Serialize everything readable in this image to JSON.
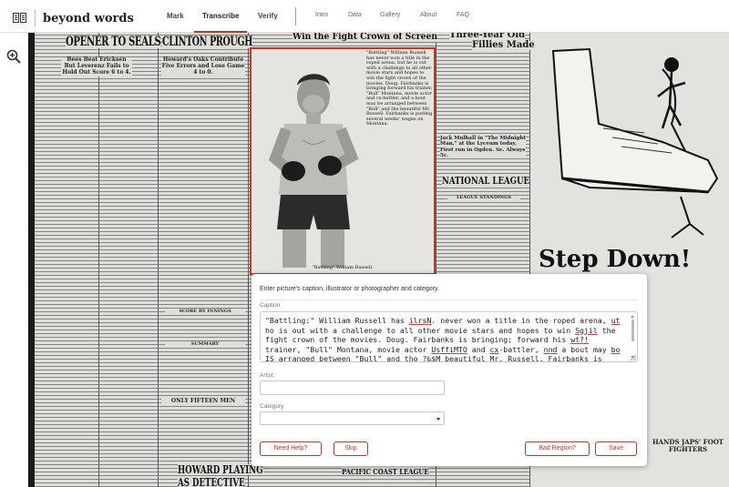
{
  "app": {
    "name": "beyond words",
    "logo_icon": "book-icon"
  },
  "nav": {
    "tabs": [
      {
        "label": "Mark",
        "active": false
      },
      {
        "label": "Transcribe",
        "active": true
      },
      {
        "label": "Verify",
        "active": false
      }
    ],
    "links": [
      "Intro",
      "Data",
      "Gallery",
      "About",
      "FAQ"
    ]
  },
  "tools": {
    "zoom_icon": "zoom-in-icon"
  },
  "newspaper": {
    "headlines": [
      "OPENER TO SEALS",
      "CLINTON PROUGH",
      "Win the Fight Crown of Screen",
      "Three-Year Old",
      "Fillies Made",
      "NATIONAL LEAGUE",
      "Step Down!",
      "HOWARD PLAYING",
      "AS DETECTIVE",
      "PACIFIC COAST LEAGUE"
    ],
    "subheads": [
      "Bees Beat Ericksen But Leverenz Fails to Hold Out Score 6 to 4.",
      "Howard's Oaks Contribute Five Errors and Lose Game 4 to 0.",
      "LEAGUE STANDINGS",
      "Jack Mulhall in \"The Midnight Man,\" at the Lyceum today. First run in Ogden. Se. Always 5c.",
      "ONLY FIFTEEN MEN",
      "SCORE BY INNINGS",
      "SUMMARY",
      "HANDS JAPS' FOOT FIGHTERS"
    ],
    "photo_blurb": "\"Battling\" William Russell has never won a title in the roped arena, but he is out with a challenge to all other movie stars and hopes to win the fight crown of the movies. Doug. Fairbanks is bringing forward his trainer, \"Bull\" Montana, movie actor and cx-battler, and a bout may be arranged between \"Bull\" and the beautiful Mr. Russell. Fairbanks is putting several weeks' wages on Montana.",
    "photo_caption": "\"Battling\" William Russell."
  },
  "dialog": {
    "instruction": "Enter picture's caption, illustrator or photographer and category.",
    "caption_label": "Caption",
    "caption_segments": [
      {
        "text": "\"Battling:\" William Russell has ",
        "flag": false
      },
      {
        "text": "ilrsN",
        "flag": true
      },
      {
        "text": ". never won a title in the roped arena, ",
        "flag": false
      },
      {
        "text": "ut",
        "flag": true
      },
      {
        "text": " ho is out with a challenge to all other movie stars and hopes to win ",
        "flag": false
      },
      {
        "text": "Sgjil",
        "flag": true
      },
      {
        "text": " the fight crown of the movies. Doug. Fairbanks is bringing; forward his ",
        "flag": false
      },
      {
        "text": "wt?!",
        "flag": true
      },
      {
        "text": " trainer, \"Bull\" Montana, movie actor ",
        "flag": false
      },
      {
        "text": "UsffiMTO",
        "flag": true
      },
      {
        "text": " and ",
        "flag": false
      },
      {
        "text": "cx",
        "flag": true
      },
      {
        "text": "-battler, ",
        "flag": false
      },
      {
        "text": "nnd",
        "flag": true
      },
      {
        "text": " a bout may ",
        "flag": false
      },
      {
        "text": "bo",
        "flag": true
      },
      {
        "text": " IS arranged between \"Bull\" and tho ",
        "flag": false
      },
      {
        "text": "?‰$M",
        "flag": true
      },
      {
        "text": " beautiful Mr. Russell. Fairbanks is",
        "flag": false
      }
    ],
    "artist_label": "Artist",
    "artist_value": "",
    "category_label": "Category",
    "category_value": "",
    "buttons": {
      "help": "Need Help?",
      "skip": "Skip",
      "bad_region": "Bad Region?",
      "save": "Save"
    },
    "accent_color": "#b03a2e"
  }
}
